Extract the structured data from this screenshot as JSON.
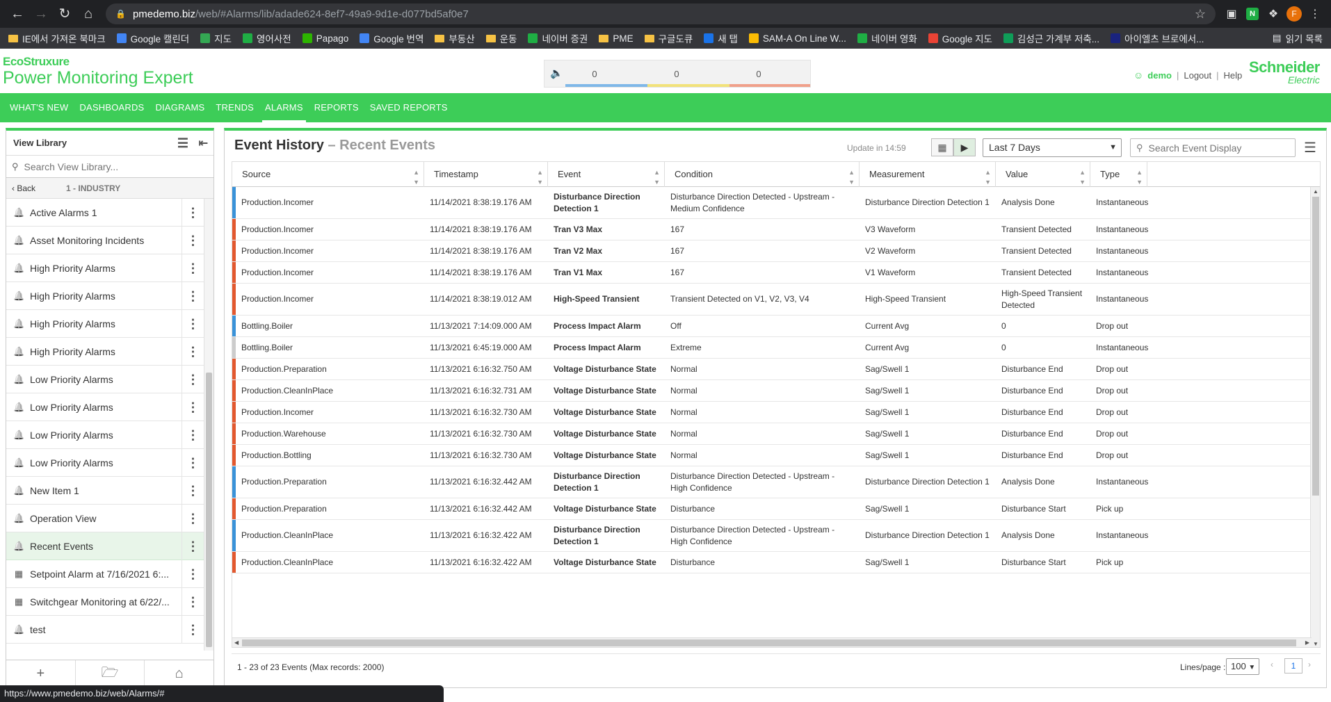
{
  "browser": {
    "url_host": "pmedemo.biz",
    "url_path": "/web/#Alarms/lib/adade624-8ef7-49a9-9d1e-d077bd5af0e7",
    "profile_initial": "F",
    "bookmarks": [
      {
        "label": "IE에서 가져온 북마크",
        "icon": "folder",
        "color": "#f6c244"
      },
      {
        "label": "Google 캘린더",
        "icon": "calendar",
        "color": "#4285f4"
      },
      {
        "label": "지도",
        "icon": "map",
        "color": "#34a853"
      },
      {
        "label": "영어사전",
        "icon": "naver-dict",
        "color": "#1fae44"
      },
      {
        "label": "Papago",
        "icon": "papago",
        "color": "#2db400"
      },
      {
        "label": "Google 번역",
        "icon": "translate",
        "color": "#4285f4"
      },
      {
        "label": "부동산",
        "icon": "folder",
        "color": "#f6c244"
      },
      {
        "label": "운동",
        "icon": "folder",
        "color": "#f6c244"
      },
      {
        "label": "네이버 증권",
        "icon": "naver",
        "color": "#1fae44"
      },
      {
        "label": "PME",
        "icon": "folder",
        "color": "#f6c244"
      },
      {
        "label": "구글도큐",
        "icon": "folder",
        "color": "#f6c244"
      },
      {
        "label": "새 탭",
        "icon": "dsm",
        "color": "#1a73e8"
      },
      {
        "label": "SAM-A On Line W...",
        "icon": "drive",
        "color": "#fbbc04"
      },
      {
        "label": "네이버 영화",
        "icon": "naver-movie",
        "color": "#1fae44"
      },
      {
        "label": "Google 지도",
        "icon": "google-maps",
        "color": "#ea4335"
      },
      {
        "label": "김성근 가계부 저축...",
        "icon": "sheets",
        "color": "#0f9d58"
      },
      {
        "label": "아이엘츠 브로에서...",
        "icon": "h-logo",
        "color": "#1a237e"
      }
    ],
    "reading_list": "읽기 목록",
    "status_url": "https://www.pmedemo.biz/web/Alarms/#"
  },
  "app": {
    "brand_eco": "EcoStruxure",
    "brand_product": "Power Monitoring Expert",
    "alarm_counts": [
      "0",
      "0",
      "0"
    ],
    "alarm_bar_colors": [
      "#7fb8e8",
      "#f2e27a",
      "#f0a08a"
    ],
    "user": "demo",
    "logout": "Logout",
    "help": "Help",
    "vendor_line1": "Schneider",
    "vendor_line2": "Electric",
    "nav": [
      {
        "label": "WHAT'S NEW",
        "active": false
      },
      {
        "label": "DASHBOARDS",
        "active": false
      },
      {
        "label": "DIAGRAMS",
        "active": false
      },
      {
        "label": "TRENDS",
        "active": false
      },
      {
        "label": "ALARMS",
        "active": true
      },
      {
        "label": "REPORTS",
        "active": false
      },
      {
        "label": "SAVED REPORTS",
        "active": false
      }
    ]
  },
  "sidebar": {
    "title": "View Library",
    "search_placeholder": "Search View Library...",
    "back": "Back",
    "breadcrumb": "1 - INDUSTRY",
    "items": [
      {
        "label": "Active Alarms 1",
        "icon": "bell-icon",
        "selected": false
      },
      {
        "label": "Asset Monitoring Incidents",
        "icon": "bell-icon",
        "selected": false
      },
      {
        "label": "High Priority Alarms",
        "icon": "bell-icon",
        "selected": false
      },
      {
        "label": "High Priority Alarms",
        "icon": "bell-icon",
        "selected": false
      },
      {
        "label": "High Priority Alarms",
        "icon": "bell-icon",
        "selected": false
      },
      {
        "label": "High Priority Alarms",
        "icon": "bell-icon",
        "selected": false
      },
      {
        "label": "Low Priority Alarms",
        "icon": "bell-icon",
        "selected": false
      },
      {
        "label": "Low Priority Alarms",
        "icon": "bell-icon",
        "selected": false
      },
      {
        "label": "Low Priority Alarms",
        "icon": "bell-icon",
        "selected": false
      },
      {
        "label": "Low Priority Alarms",
        "icon": "bell-icon",
        "selected": false
      },
      {
        "label": "New Item 1",
        "icon": "bell-icon",
        "selected": false
      },
      {
        "label": "Operation View",
        "icon": "bell-icon",
        "selected": false
      },
      {
        "label": "Recent Events",
        "icon": "bell-icon",
        "selected": true
      },
      {
        "label": "Setpoint Alarm at 7/16/2021 6:...",
        "icon": "setpoint-icon",
        "selected": false
      },
      {
        "label": "Switchgear Monitoring at 6/22/...",
        "icon": "setpoint-icon",
        "selected": false
      },
      {
        "label": "test",
        "icon": "bell-icon",
        "selected": false
      }
    ]
  },
  "panel": {
    "title": "Event History",
    "subtitle": "– Recent Events",
    "update": "Update in 14:59",
    "range": "Last 7 Days",
    "search_placeholder": "Search Event Display",
    "columns": [
      "Source",
      "Timestamp",
      "Event",
      "Condition",
      "Measurement",
      "Value",
      "Type"
    ],
    "severity_colors": {
      "high": "#e2582f",
      "info": "#3a92d8",
      "low": "#cccccc"
    },
    "rows": [
      {
        "sev": "info",
        "source": "Production.Incomer",
        "timestamp": "11/14/2021 8:38:19.176 AM",
        "event": "Disturbance Direction Detection 1",
        "condition": "Disturbance Direction Detected - Upstream - Medium Confidence",
        "measurement": "Disturbance Direction Detection 1",
        "value": "Analysis Done",
        "type": "Instantaneous",
        "tall": true
      },
      {
        "sev": "high",
        "source": "Production.Incomer",
        "timestamp": "11/14/2021 8:38:19.176 AM",
        "event": "Tran V3 Max",
        "condition": "167",
        "measurement": "V3 Waveform",
        "value": "Transient Detected",
        "type": "Instantaneous"
      },
      {
        "sev": "high",
        "source": "Production.Incomer",
        "timestamp": "11/14/2021 8:38:19.176 AM",
        "event": "Tran V2 Max",
        "condition": "167",
        "measurement": "V2 Waveform",
        "value": "Transient Detected",
        "type": "Instantaneous"
      },
      {
        "sev": "high",
        "source": "Production.Incomer",
        "timestamp": "11/14/2021 8:38:19.176 AM",
        "event": "Tran V1 Max",
        "condition": "167",
        "measurement": "V1 Waveform",
        "value": "Transient Detected",
        "type": "Instantaneous"
      },
      {
        "sev": "high",
        "source": "Production.Incomer",
        "timestamp": "11/14/2021 8:38:19.012 AM",
        "event": "High-Speed Transient",
        "condition": "Transient Detected on V1, V2, V3, V4",
        "measurement": "High-Speed Transient",
        "value": "High-Speed Transient Detected",
        "type": "Instantaneous",
        "tall": true
      },
      {
        "sev": "info",
        "source": "Bottling.Boiler",
        "timestamp": "11/13/2021 7:14:09.000 AM",
        "event": "Process Impact Alarm",
        "condition": "Off",
        "measurement": "Current Avg",
        "value": "0",
        "type": "Drop out"
      },
      {
        "sev": "low",
        "source": "Bottling.Boiler",
        "timestamp": "11/13/2021 6:45:19.000 AM",
        "event": "Process Impact Alarm",
        "condition": "Extreme",
        "measurement": "Current Avg",
        "value": "0",
        "type": "Instantaneous"
      },
      {
        "sev": "high",
        "source": "Production.Preparation",
        "timestamp": "11/13/2021 6:16:32.750 AM",
        "event": "Voltage Disturbance State",
        "condition": "Normal",
        "measurement": "Sag/Swell 1",
        "value": "Disturbance End",
        "type": "Drop out"
      },
      {
        "sev": "high",
        "source": "Production.CleanInPlace",
        "timestamp": "11/13/2021 6:16:32.731 AM",
        "event": "Voltage Disturbance State",
        "condition": "Normal",
        "measurement": "Sag/Swell 1",
        "value": "Disturbance End",
        "type": "Drop out"
      },
      {
        "sev": "high",
        "source": "Production.Incomer",
        "timestamp": "11/13/2021 6:16:32.730 AM",
        "event": "Voltage Disturbance State",
        "condition": "Normal",
        "measurement": "Sag/Swell 1",
        "value": "Disturbance End",
        "type": "Drop out"
      },
      {
        "sev": "high",
        "source": "Production.Warehouse",
        "timestamp": "11/13/2021 6:16:32.730 AM",
        "event": "Voltage Disturbance State",
        "condition": "Normal",
        "measurement": "Sag/Swell 1",
        "value": "Disturbance End",
        "type": "Drop out"
      },
      {
        "sev": "high",
        "source": "Production.Bottling",
        "timestamp": "11/13/2021 6:16:32.730 AM",
        "event": "Voltage Disturbance State",
        "condition": "Normal",
        "measurement": "Sag/Swell 1",
        "value": "Disturbance End",
        "type": "Drop out"
      },
      {
        "sev": "info",
        "source": "Production.Preparation",
        "timestamp": "11/13/2021 6:16:32.442 AM",
        "event": "Disturbance Direction Detection 1",
        "condition": "Disturbance Direction Detected - Upstream - High Confidence",
        "measurement": "Disturbance Direction Detection 1",
        "value": "Analysis Done",
        "type": "Instantaneous",
        "tall": true
      },
      {
        "sev": "high",
        "source": "Production.Preparation",
        "timestamp": "11/13/2021 6:16:32.442 AM",
        "event": "Voltage Disturbance State",
        "condition": "Disturbance",
        "measurement": "Sag/Swell 1",
        "value": "Disturbance Start",
        "type": "Pick up"
      },
      {
        "sev": "info",
        "source": "Production.CleanInPlace",
        "timestamp": "11/13/2021 6:16:32.422 AM",
        "event": "Disturbance Direction Detection 1",
        "condition": "Disturbance Direction Detected - Upstream - High Confidence",
        "measurement": "Disturbance Direction Detection 1",
        "value": "Analysis Done",
        "type": "Instantaneous",
        "tall": true
      },
      {
        "sev": "high",
        "source": "Production.CleanInPlace",
        "timestamp": "11/13/2021 6:16:32.422 AM",
        "event": "Voltage Disturbance State",
        "condition": "Disturbance",
        "measurement": "Sag/Swell 1",
        "value": "Disturbance Start",
        "type": "Pick up"
      }
    ],
    "footer_count": "1 - 23 of 23 Events (Max records: 2000)",
    "lines_per_page_label": "Lines/page :",
    "lines_per_page": "100",
    "page": "1"
  }
}
